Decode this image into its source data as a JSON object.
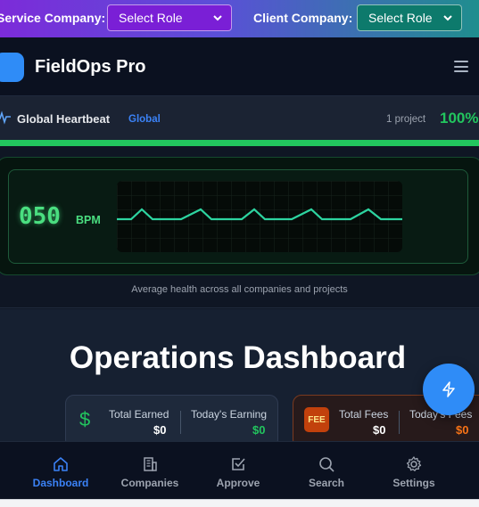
{
  "roles": {
    "service_label": "Service Company:",
    "service_value": "Select Role",
    "client_label": "Client Company:",
    "client_value": "Select Role"
  },
  "header": {
    "app_name": "FieldOps Pro"
  },
  "heartbeat": {
    "title": "Global Heartbeat",
    "scope": "Global",
    "project_count": "1 project",
    "health_percent": "100%",
    "health_fraction": 1.0,
    "bpm": "050",
    "bpm_unit": "BPM",
    "caption": "Average health across all companies and projects"
  },
  "dashboard": {
    "title": "Operations Dashboard",
    "earnings": {
      "icon": "dollar-icon",
      "total_label": "Total Earned",
      "total_value": "$0",
      "today_label": "Today's Earning",
      "today_value": "$0"
    },
    "fees": {
      "badge": "FEE",
      "total_label": "Total Fees",
      "total_value": "$0",
      "today_label": "Today's Fees",
      "today_value": "$0"
    }
  },
  "nav": {
    "items": [
      {
        "label": "Dashboard",
        "icon": "home-icon",
        "active": true
      },
      {
        "label": "Companies",
        "icon": "building-icon",
        "active": false
      },
      {
        "label": "Approve",
        "icon": "checkbox-icon",
        "active": false
      },
      {
        "label": "Search",
        "icon": "search-icon",
        "active": false
      },
      {
        "label": "Settings",
        "icon": "gear-icon",
        "active": false
      }
    ]
  },
  "colors": {
    "accent": "#2f8cf7",
    "health_green": "#22c55e",
    "fee_orange": "#f97316"
  }
}
